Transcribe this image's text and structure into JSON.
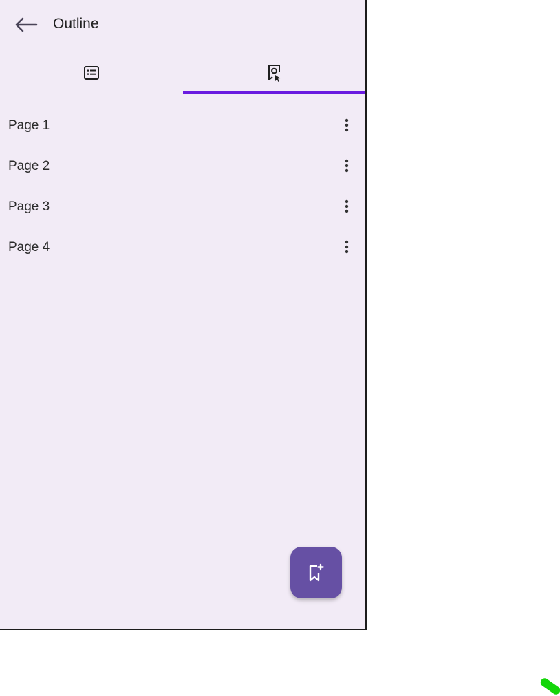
{
  "header": {
    "back_icon": "arrow-back-icon",
    "title": "Outline"
  },
  "tabs": [
    {
      "icon": "list-outline-icon",
      "selected": false
    },
    {
      "icon": "bookmark-page-icon",
      "selected": true
    }
  ],
  "bookmarks": [
    {
      "label": "Page 1",
      "menu_icon": "more-vert-icon"
    },
    {
      "label": "Page 2",
      "menu_icon": "more-vert-icon"
    },
    {
      "label": "Page 3",
      "menu_icon": "more-vert-icon"
    },
    {
      "label": "Page 4",
      "menu_icon": "more-vert-icon"
    }
  ],
  "fab": {
    "icon": "bookmark-add-icon"
  },
  "colors": {
    "panel_background": "#f2ebf6",
    "tab_indicator": "#6a1be0",
    "fab_background": "#6650a4",
    "touch_indicator": "#14d60a"
  }
}
